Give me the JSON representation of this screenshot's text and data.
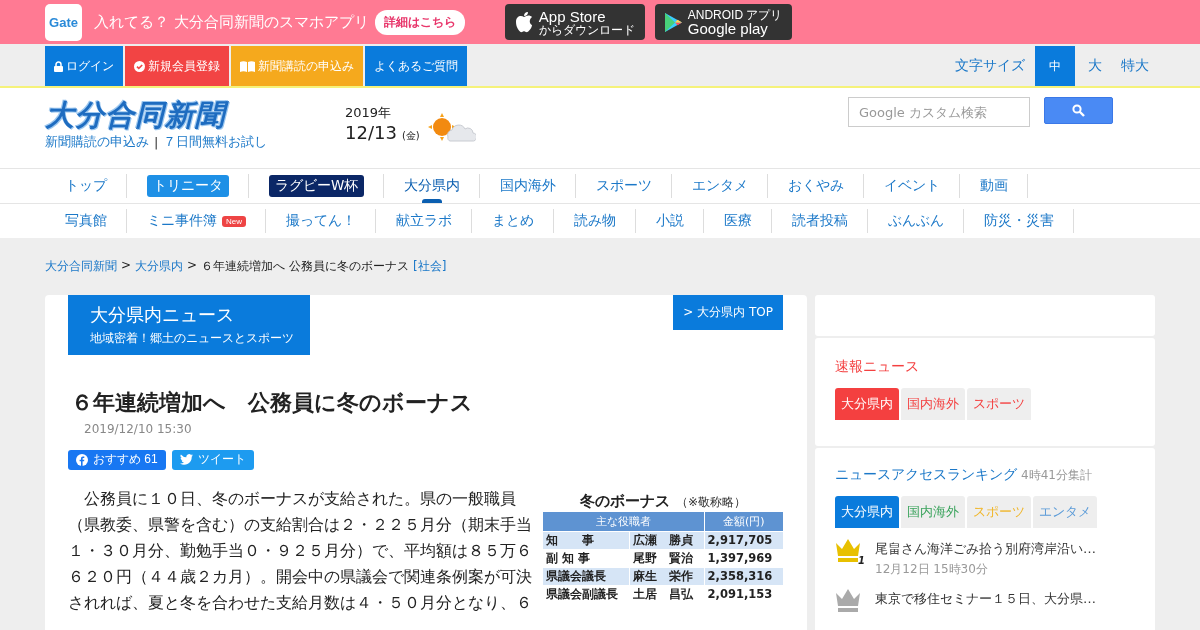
{
  "app_banner": {
    "logo": "Gate",
    "text": "入れてる？ 大分合同新聞のスマホアプリ",
    "button": "詳細はこちら",
    "app_store": {
      "title": "App Store",
      "caption": "からダウンロード"
    },
    "google_play": {
      "caption": "ANDROID アプリ",
      "title": "Google play"
    }
  },
  "account_links": [
    {
      "label": "ログイン",
      "kind": "lock",
      "color": "#0a7bdc"
    },
    {
      "label": "新規会員登録",
      "kind": "check",
      "color": "#f24444"
    },
    {
      "label": "新聞講読の申込み",
      "kind": "book",
      "color": "#f5a91d"
    },
    {
      "label": "よくあるご質問",
      "kind": "plain",
      "color": "#0a7bdc"
    }
  ],
  "font_size": {
    "label": "文字サイズ",
    "options": [
      {
        "label": "中",
        "selected": true
      },
      {
        "label": "大",
        "selected": false
      },
      {
        "label": "特大",
        "selected": false
      }
    ]
  },
  "header": {
    "logo": "大分合同新聞",
    "links": [
      "新聞購読の申込み",
      "７日間無料お試し"
    ],
    "separator": "|",
    "year": "2019年",
    "date": "12/13",
    "weekday": "(金)",
    "search_placeholder": "Google カスタム検索"
  },
  "nav_primary": [
    {
      "label": "トップ",
      "kind": "plain",
      "selected": false
    },
    {
      "label": "トリニータ",
      "kind": "pill",
      "selected": false
    },
    {
      "label": "ラグビーW杯",
      "kind": "dark",
      "selected": false
    },
    {
      "label": "大分県内",
      "kind": "plain",
      "selected": true
    },
    {
      "label": "国内海外",
      "kind": "plain",
      "selected": false
    },
    {
      "label": "スポーツ",
      "kind": "plain",
      "selected": false
    },
    {
      "label": "エンタメ",
      "kind": "plain",
      "selected": false
    },
    {
      "label": "おくやみ",
      "kind": "plain",
      "selected": false
    },
    {
      "label": "イベント",
      "kind": "plain",
      "selected": false
    },
    {
      "label": "動画",
      "kind": "plain",
      "selected": false
    }
  ],
  "nav_secondary": [
    {
      "label": "写真館"
    },
    {
      "label": "ミニ事件簿",
      "badge": "New"
    },
    {
      "label": "撮ってん！"
    },
    {
      "label": "献立ラボ"
    },
    {
      "label": "まとめ"
    },
    {
      "label": "読み物"
    },
    {
      "label": "小説"
    },
    {
      "label": "医療"
    },
    {
      "label": "読者投稿"
    },
    {
      "label": "ぶんぶん"
    },
    {
      "label": "防災・災害"
    }
  ],
  "breadcrumb": {
    "links": [
      "大分合同新聞",
      "大分県内"
    ],
    "separator": ">",
    "current": "６年連続増加へ 公務員に冬のボーナス",
    "category": "[社会]"
  },
  "section": {
    "title": "大分県内ニュース",
    "subtitle": "地域密着！郷土のニュースとスポーツ",
    "top_link": "> 大分県内 TOP"
  },
  "article": {
    "title": "６年連続増加へ　公務員に冬のボーナス",
    "date": "2019/12/10 15:30",
    "facebook": "おすすめ 61",
    "twitter": "ツイート",
    "body": "　公務員に１０日、冬のボーナスが支給された。県の一般職員（県教委、県警を含む）の支給割合は２・２２５月分（期末手当１・３０月分、勤勉手当０・９２５月分）で、平均額は８５万６６２０円（４４歳２カ月）。開会中の県議会で関連条例案が可決されれば、夏と冬を合わせた支給月数は４・５０月分となり、６",
    "table": {
      "title": "冬のボーナス",
      "note": "（※敬称略）",
      "columns": [
        "主な役職者",
        "金額(円)"
      ],
      "rows": [
        {
          "role": "知　　事",
          "name": "広瀬　勝貞",
          "amount": "2,917,705"
        },
        {
          "role": "副 知 事",
          "name": "尾野　賢治",
          "amount": "1,397,969"
        },
        {
          "role": "県議会議長",
          "name": "麻生　栄作",
          "amount": "2,358,316"
        },
        {
          "role": "県議会副議長",
          "name": "土居　昌弘",
          "amount": "2,091,153"
        }
      ]
    }
  },
  "sidebar": {
    "breaking": {
      "title": "速報ニュース",
      "tabs": [
        {
          "label": "大分県内",
          "selected": true
        },
        {
          "label": "国内海外",
          "selected": false
        },
        {
          "label": "スポーツ",
          "selected": false
        }
      ]
    },
    "ranking": {
      "title": "ニュースアクセスランキング",
      "updated": "4時41分集計",
      "tabs": [
        {
          "label": "大分県内",
          "selected": true,
          "color": "#0a7bdc"
        },
        {
          "label": "国内海外",
          "selected": false,
          "color": "#3aa35c"
        },
        {
          "label": "スポーツ",
          "selected": false,
          "color": "#f0b62a"
        },
        {
          "label": "エンタメ",
          "selected": false,
          "color": "#5b9bd8"
        }
      ],
      "items": [
        {
          "rank": "1",
          "title": "尾畠さん海洋ごみ拾う別府湾岸沿い…",
          "time": "12月12日 15時30分",
          "color": "#e8c000"
        },
        {
          "title": "東京で移住セミナー１５日、大分県…",
          "color": "#aaaaaa"
        }
      ]
    }
  }
}
